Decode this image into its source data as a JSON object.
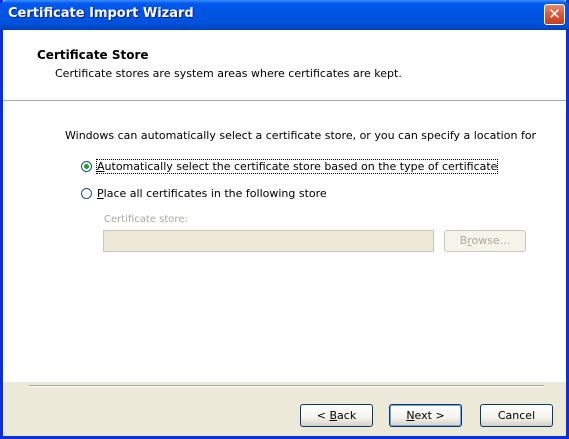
{
  "window": {
    "title": "Certificate Import Wizard",
    "close_glyph": "✕",
    "title_color": "#0054e3",
    "close_color": "#d95d3d"
  },
  "header": {
    "title": "Certificate Store",
    "subtitle": "Certificate stores are system areas where certificates are kept."
  },
  "body": {
    "intro": "Windows can automatically select a certificate store, or you can specify a location for",
    "options": [
      {
        "accel": "A",
        "rest": "utomatically select the certificate store based on the type of certificate",
        "selected": true
      },
      {
        "accel": "P",
        "rest": "lace all certificates in the following store",
        "selected": false
      }
    ],
    "store_label": "Certificate store:",
    "store_value": "",
    "browse_accel": "r",
    "browse_pre": "B",
    "browse_post": "owse..."
  },
  "footer": {
    "back_pre": "< ",
    "back_accel": "B",
    "back_post": "ack",
    "next_accel": "N",
    "next_post": "ext >",
    "cancel": "Cancel"
  }
}
